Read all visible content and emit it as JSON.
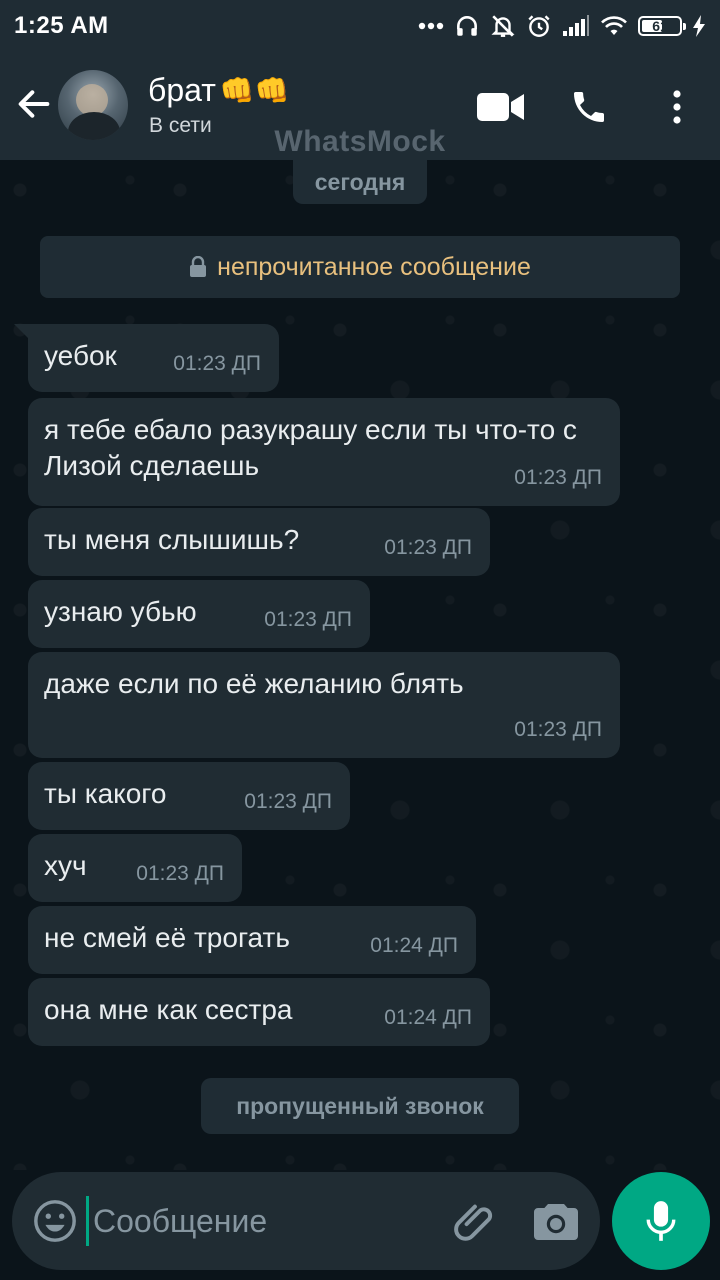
{
  "status_bar": {
    "time": "1:25 AM",
    "battery_level": "61",
    "battery_fraction": 0.61,
    "icons": [
      "more-dots-icon",
      "headphones-icon",
      "alarm-off-icon",
      "alarm-icon",
      "signal-icon",
      "wifi-icon",
      "battery-icon",
      "charging-icon"
    ]
  },
  "header": {
    "contact_name": "брат",
    "name_emoji": "👊👊",
    "contact_status": "В сети",
    "watermark": "WhatsMock",
    "icons": [
      "back-arrow-icon",
      "video-call-icon",
      "phone-call-icon",
      "more-vert-icon"
    ]
  },
  "chat": {
    "date_label": "сегодня",
    "unread_label": "непрочитанное сообщение",
    "messages": [
      {
        "text": "уебок",
        "time": "01:23 ДП"
      },
      {
        "text": "я тебе ебало разукрашу если ты что-то с Лизой сделаешь",
        "time": "01:23 ДП"
      },
      {
        "text": "ты меня слышишь?",
        "time": "01:23 ДП"
      },
      {
        "text": "узнаю убью",
        "time": "01:23 ДП"
      },
      {
        "text": "даже если по её желанию блять",
        "time": "01:23 ДП"
      },
      {
        "text": "ты какого",
        "time": "01:23 ДП"
      },
      {
        "text": "хуч",
        "time": "01:23 ДП"
      },
      {
        "text": "не смей её трогать",
        "time": "01:24 ДП"
      },
      {
        "text": "она мне как сестра",
        "time": "01:24 ДП"
      }
    ],
    "missed_call_label": "пропущенный звонок"
  },
  "input": {
    "placeholder": "Сообщение",
    "value": "",
    "icons": [
      "emoji-icon",
      "attach-icon",
      "camera-icon",
      "mic-icon"
    ]
  },
  "colors": {
    "header_bg": "#1f2c34",
    "chat_bg": "#0b141a",
    "bubble_bg": "#202c33",
    "accent": "#00a884",
    "unread_text": "#e8c07e",
    "meta_text": "#8696a0"
  }
}
